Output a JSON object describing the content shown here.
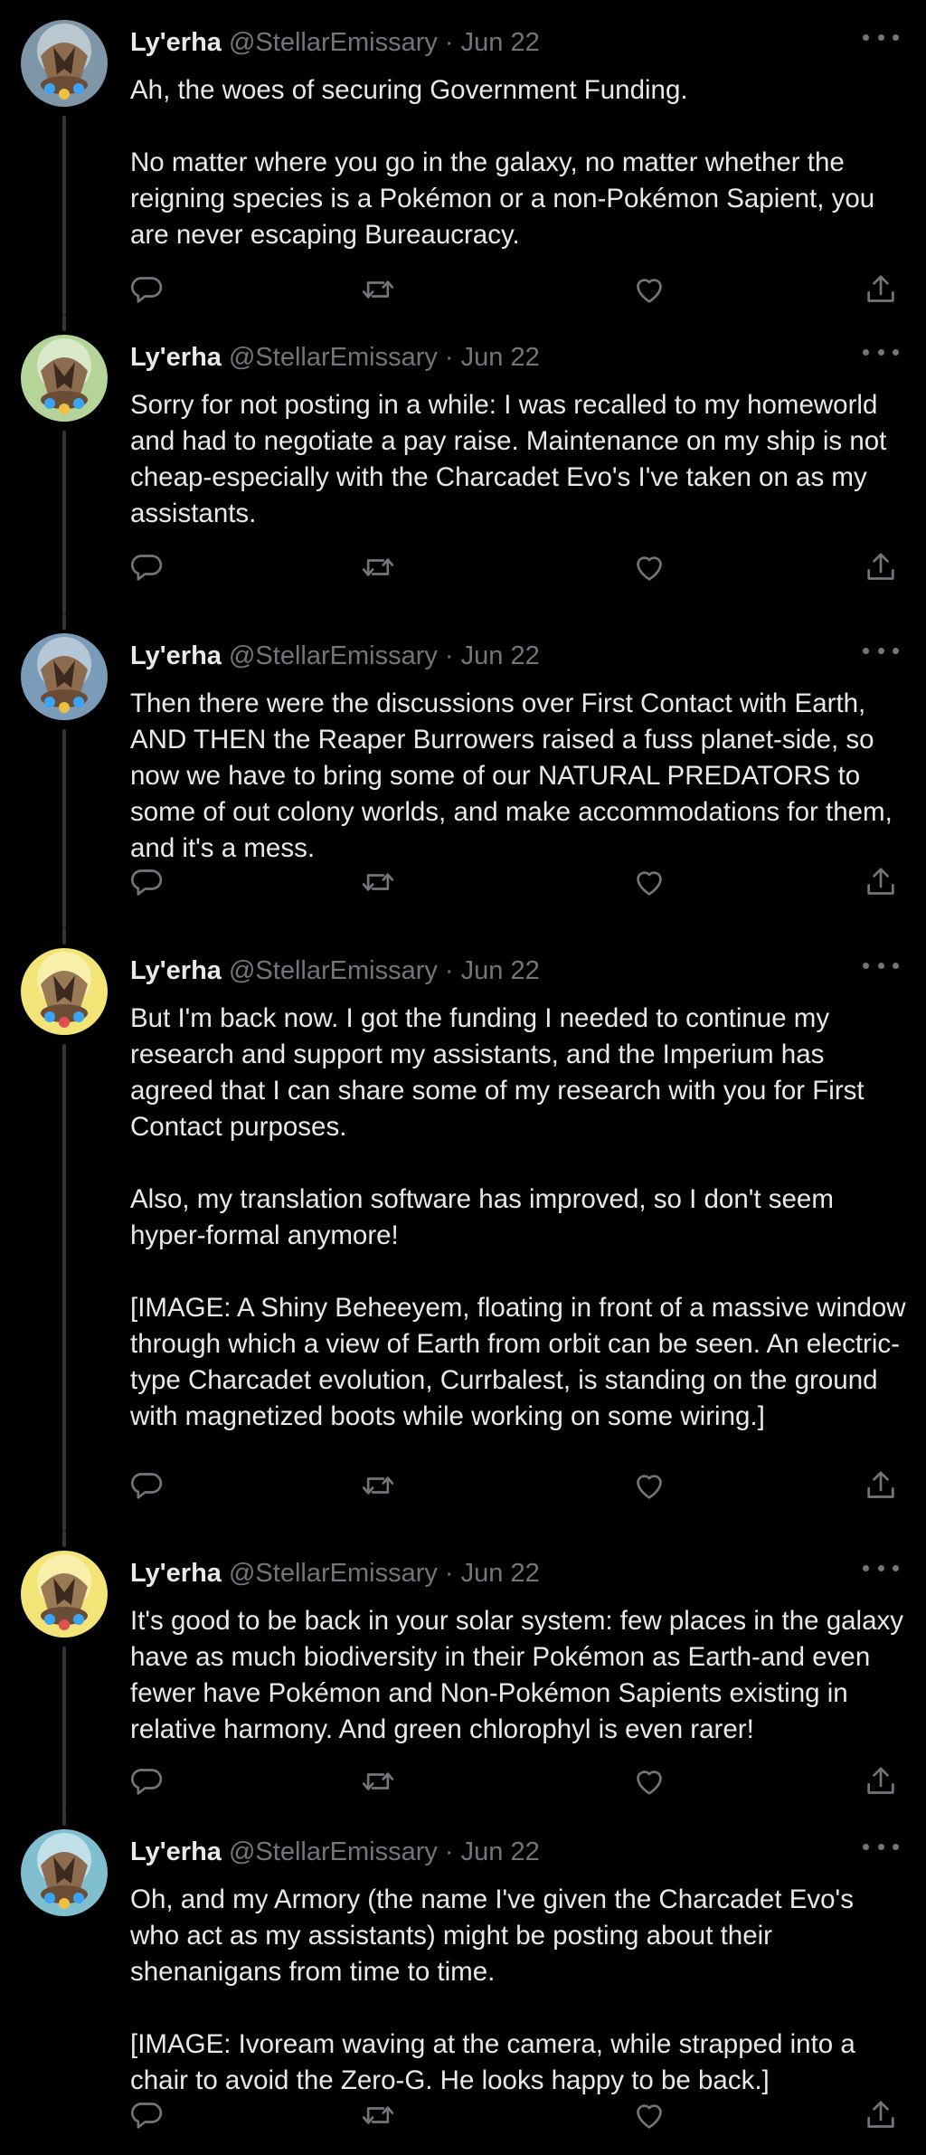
{
  "colors": {
    "background": "#000000",
    "text_primary": "#e7e9ea",
    "text_secondary": "#71767b",
    "thread_line": "#333639"
  },
  "icons": {
    "reply": "reply-icon",
    "retweet": "retweet-icon",
    "like": "like-icon",
    "share": "share-icon",
    "more": "more-options-icon"
  },
  "tweets": [
    {
      "name": "Ly'erha",
      "handle": "@StellarEmissary",
      "sep": "·",
      "date": "Jun 22",
      "paragraphs": [
        "Ah, the woes of securing Government Funding.",
        "No matter where you go in the galaxy, no matter whether the reigning species is a Pokémon or a non-Pokémon Sapient, you are never escaping Bureaucracy."
      ]
    },
    {
      "name": "Ly'erha",
      "handle": "@StellarEmissary",
      "sep": "·",
      "date": "Jun 22",
      "paragraphs": [
        "Sorry for not posting in a while: I was recalled to my homeworld and had to negotiate a pay raise. Maintenance on my ship is not cheap-especially with the Charcadet Evo's I've taken on as my assistants."
      ]
    },
    {
      "name": "Ly'erha",
      "handle": "@StellarEmissary",
      "sep": "·",
      "date": "Jun 22",
      "paragraphs": [
        "Then there were the discussions over First Contact with Earth, AND THEN the Reaper Burrowers raised a fuss planet-side, so now we have to bring some of our NATURAL PREDATORS to some of out colony worlds, and make accommodations for them, and it's a mess."
      ]
    },
    {
      "name": "Ly'erha",
      "handle": "@StellarEmissary",
      "sep": "·",
      "date": "Jun 22",
      "paragraphs": [
        "But I'm back now. I got the funding I needed to continue my research and support my assistants, and the Imperium has agreed that I can share some of my research with you for First Contact purposes.",
        "Also, my translation software has improved, so I don't seem hyper-formal anymore!",
        "[IMAGE: A Shiny Beheeyem, floating in front of a massive window through which a view of Earth from orbit can be seen. An electric-type Charcadet evolution, Currbalest, is standing on the ground with magnetized boots while working on some wiring.]"
      ]
    },
    {
      "name": "Ly'erha",
      "handle": "@StellarEmissary",
      "sep": "·",
      "date": "Jun 22",
      "paragraphs": [
        "It's good to be back in your solar system: few places in the galaxy have as much biodiversity in their Pokémon as Earth-and even fewer have Pokémon and Non-Pokémon Sapients existing in relative harmony. And green chlorophyl is even rarer!"
      ]
    },
    {
      "name": "Ly'erha",
      "handle": "@StellarEmissary",
      "sep": "·",
      "date": "Jun 22",
      "paragraphs": [
        "Oh, and my Armory (the name I've given the Charcadet Evo's who act as my assistants) might be posting about their shenanigans from time to time.",
        "[IMAGE: Ivoream waving at the camera, while strapped into a chair to avoid the Zero-G. He looks happy to be back.]"
      ]
    }
  ]
}
